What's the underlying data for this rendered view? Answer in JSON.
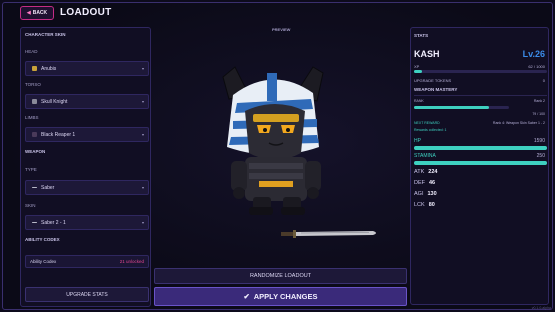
{
  "header": {
    "back_label": "BACK",
    "title": "LOADOUT"
  },
  "left": {
    "skin_section": "CHARACTER SKIN",
    "head_label": "HEAD",
    "head_value": "Anubis",
    "torso_label": "TORSO",
    "torso_value": "Skull Knight",
    "limbs_label": "LIMBS",
    "limbs_value": "Black Reaper 1",
    "weapon_section": "WEAPON",
    "type_label": "TYPE",
    "type_value": "Saber",
    "skin_label": "SKIN",
    "skin_value": "Saber 2 - 1",
    "codex_section": "ABILITY CODEX",
    "codex_label": "Ability Codex",
    "codex_count": "21 unlocked",
    "upgrade_label": "UPGRADE STATS"
  },
  "center": {
    "preview_label": "PREVIEW",
    "randomize_label": "RANDOMIZE LOADOUT",
    "apply_label": "APPLY CHANGES",
    "apply_icon": "check-icon"
  },
  "stats": {
    "section": "STATS",
    "name": "KASH",
    "level": "Lv.26",
    "xp_label": "XP",
    "xp_value": "62 / 1000",
    "xp_fraction": 0.062,
    "tokens_label": "UPGRADE TOKENS",
    "tokens_value": "0",
    "mastery_section": "WEAPON MASTERY",
    "rank_label": "RANK",
    "rank_value": "Rank 2",
    "rank_progress_text": "79 / 100",
    "rank_fraction": 0.79,
    "next_reward_label": "NEXT REWARD",
    "next_reward_value": "Rank 4: Weapon Skin Saber 1 - 2",
    "rewards_collected": "Rewards collected: 1",
    "hp_label": "HP",
    "hp_value": "1590",
    "hp_fraction": 1.0,
    "stamina_label": "STAMINA",
    "stamina_value": "250",
    "stamina_fraction": 1.0,
    "atk_label": "ATK",
    "atk_value": "224",
    "def_label": "DEF",
    "def_value": "46",
    "agi_label": "AGI",
    "agi_value": "130",
    "lck_label": "LCK",
    "lck_value": "80"
  },
  "footer": {
    "version": "v0.1.0-alpha"
  },
  "colors": {
    "accent": "#3ed0c0",
    "level": "#3b8be8",
    "back_border": "#c32c86",
    "apply_bg": "#3a2a7a"
  }
}
